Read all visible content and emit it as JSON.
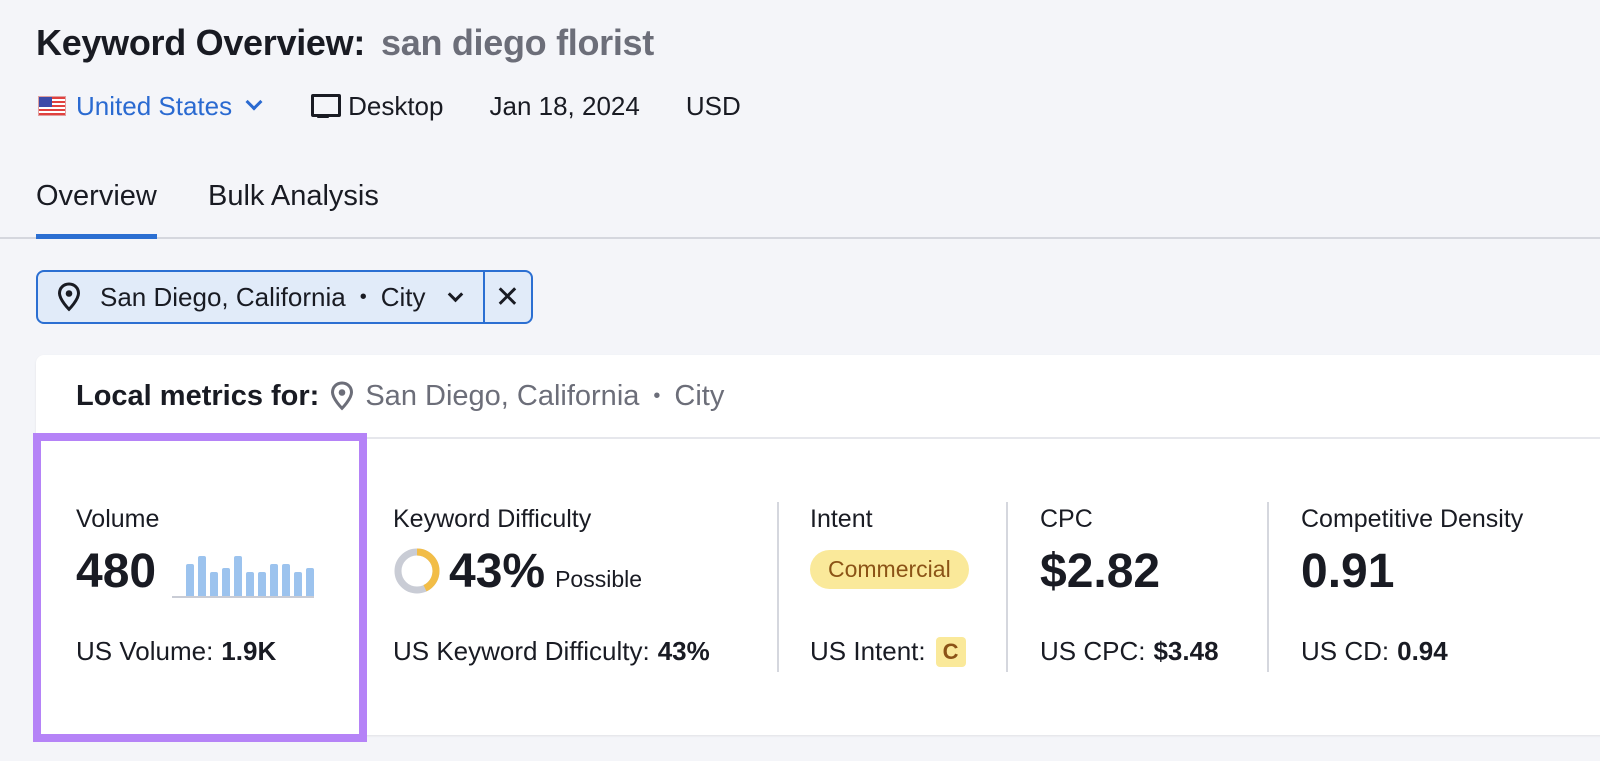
{
  "header": {
    "title": "Keyword Overview:",
    "keyword": "san diego florist",
    "country": "United States",
    "device": "Desktop",
    "date": "Jan 18, 2024",
    "currency": "USD"
  },
  "tabs": [
    {
      "label": "Overview",
      "active": true
    },
    {
      "label": "Bulk Analysis",
      "active": false
    }
  ],
  "location_filter": {
    "location": "San Diego, California",
    "separator": "•",
    "type": "City"
  },
  "card": {
    "label": "Local metrics for:",
    "location": "San Diego, California",
    "separator": "•",
    "type": "City"
  },
  "metrics": {
    "volume": {
      "label": "Volume",
      "value": "480",
      "sub_label": "US Volume:",
      "sub_value": "1.9K",
      "trend": [
        0.8,
        1.0,
        0.6,
        0.7,
        1.0,
        0.6,
        0.6,
        0.8,
        0.8,
        0.6,
        0.7
      ]
    },
    "kd": {
      "label": "Keyword Difficulty",
      "value": "43%",
      "percent": 43,
      "rating": "Possible",
      "sub_label": "US Keyword Difficulty:",
      "sub_value": "43%",
      "color": "#f2bd47"
    },
    "intent": {
      "label": "Intent",
      "badge": "Commercial",
      "sub_label": "US Intent:",
      "sub_value": "C"
    },
    "cpc": {
      "label": "CPC",
      "value": "$2.82",
      "sub_label": "US CPC:",
      "sub_value": "$3.48"
    },
    "cd": {
      "label": "Competitive Density",
      "value": "0.91",
      "sub_label": "US CD:",
      "sub_value": "0.94"
    }
  },
  "colors": {
    "accent": "#2b6fd2",
    "highlight": "#b583f7",
    "spark": "#9cc3ee",
    "intent_bg": "#fae99a"
  }
}
